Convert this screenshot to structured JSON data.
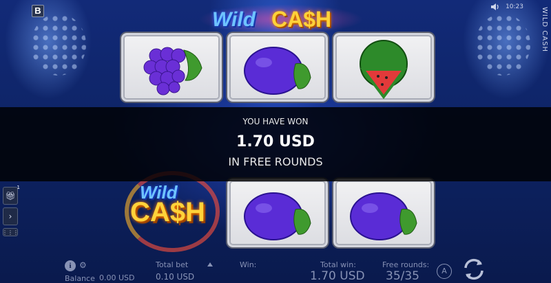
{
  "header": {
    "logo_letter": "B",
    "title_wild": "Wild",
    "title_cash": "CA$H",
    "time": "10:23",
    "side_title": "WILD CASH"
  },
  "reels": {
    "symbols": [
      [
        "grapes-icon",
        "plum-icon",
        "watermelon-icon"
      ],
      [
        "wild-cash-symbol",
        "plum-icon",
        "plum-icon"
      ]
    ],
    "wild_word": "Wild",
    "cash_word": "CA$H"
  },
  "win_banner": {
    "line1": "YOU HAVE WON",
    "amount": "1.70 USD",
    "line3": "IN FREE ROUNDS"
  },
  "left_tools": {
    "gift_badge": "1",
    "expand_glyph": "›",
    "menu_glyph": "⋮⋮⋮"
  },
  "footer": {
    "balance_label": "Balance",
    "balance_value": "0.00 USD",
    "total_bet_label": "Total bet",
    "total_bet_value": "0.10 USD",
    "win_label": "Win:",
    "total_win_label": "Total win:",
    "total_win_value": "1.70 USD",
    "free_rounds_label": "Free rounds:",
    "free_rounds_value": "35/35",
    "info_glyph": "i",
    "auto_label": "A"
  },
  "colors": {
    "background": "#0e2466",
    "banner": "#000000",
    "gold": "#ffd23a",
    "wild_blue": "#6fc3ff",
    "footer_text": "#8792b5"
  }
}
